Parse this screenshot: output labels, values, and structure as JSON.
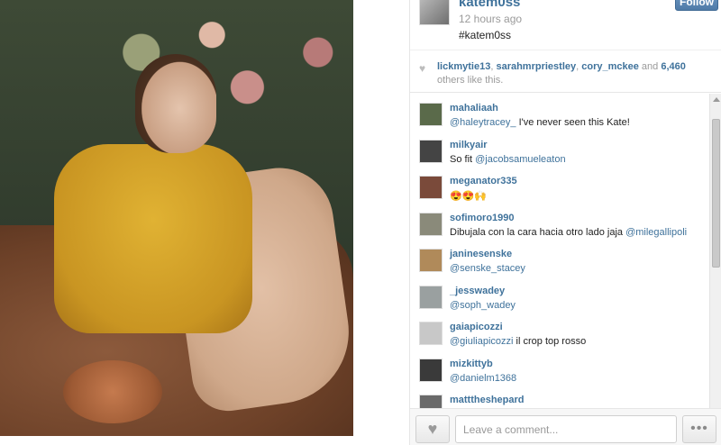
{
  "post": {
    "username": "katem0ss",
    "time": "12 hours ago",
    "caption": "#katem0ss",
    "follow_label": "Follow"
  },
  "likes": {
    "users": [
      "lickmytie13",
      "sarahmrpriestley",
      "cory_mckee"
    ],
    "sep1": ", ",
    "sep2": ", ",
    "and_text": " and ",
    "count": "6,460",
    "others_text": "others like this."
  },
  "comments": [
    {
      "user": "mahaliaah",
      "mention": "@haleytracey_",
      "text": " I've never seen this Kate!",
      "avatar_color": "#5a6a4a"
    },
    {
      "user": "milkyair",
      "pre": "So fit ",
      "mention": "@jacobsamueleaton",
      "avatar_color": "#444444"
    },
    {
      "user": "meganator335",
      "text": "😍😍🙌",
      "avatar_color": "#7a4a3a"
    },
    {
      "user": "sofimoro1990",
      "text": "Dibujala con la cara hacia otro lado jaja ",
      "mention": "@milegallipoli",
      "avatar_color": "#8a8a7a"
    },
    {
      "user": "janinesenske",
      "mention": "@senske_stacey",
      "avatar_color": "#b08a5a"
    },
    {
      "user": "_jesswadey",
      "mention": "@soph_wadey",
      "avatar_color": "#9aa0a0"
    },
    {
      "user": "gaiapicozzi",
      "mention": "@giuliapicozzi",
      "text": " il crop top rosso",
      "avatar_color": "#c8c8c8"
    },
    {
      "user": "mizkittyb",
      "mention": "@danielm1368",
      "avatar_color": "#3a3a3a"
    },
    {
      "user": "matttheshepard",
      "avatar_color": "#6a6a6a"
    }
  ],
  "footer": {
    "comment_placeholder": "Leave a comment...",
    "like_icon": "heart-icon",
    "more_label": "•••"
  },
  "colors": {
    "link": "#3f729b",
    "follow_button": "#4f7ba8"
  }
}
